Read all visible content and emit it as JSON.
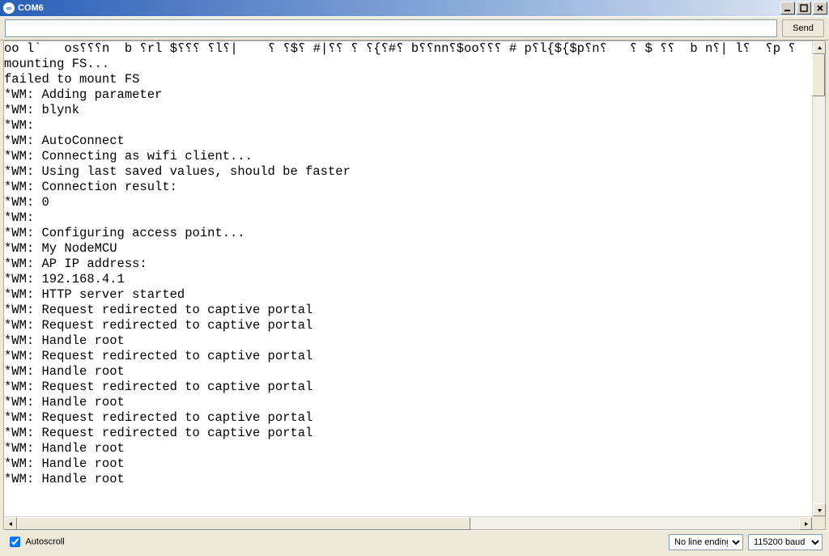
{
  "window": {
    "title": "COM6",
    "icon_glyph": "∞"
  },
  "toolbar": {
    "input_value": "",
    "send_label": "Send"
  },
  "console_lines": [
    "oo l`   os⸮⸮⸮n  b ⸮rl $⸮⸮⸮ ⸮l⸮|    ⸮ ⸮$⸮ #|⸮⸮ ⸮ ⸮{⸮#⸮ b⸮⸮nn⸮$oo⸮⸮⸮ # p⸮l{${$p⸮n⸮   ⸮ $ ⸮⸮  b n⸮| l⸮  ⸮p ⸮",
    "mounting FS...",
    "failed to mount FS",
    "*WM: Adding parameter",
    "*WM: blynk",
    "*WM: ",
    "*WM: AutoConnect",
    "*WM: Connecting as wifi client...",
    "*WM: Using last saved values, should be faster",
    "*WM: Connection result: ",
    "*WM: 0",
    "*WM: ",
    "*WM: Configuring access point... ",
    "*WM: My NodeMCU",
    "*WM: AP IP address: ",
    "*WM: 192.168.4.1",
    "*WM: HTTP server started",
    "*WM: Request redirected to captive portal",
    "*WM: Request redirected to captive portal",
    "*WM: Handle root",
    "*WM: Request redirected to captive portal",
    "*WM: Handle root",
    "*WM: Request redirected to captive portal",
    "*WM: Handle root",
    "*WM: Request redirected to captive portal",
    "*WM: Request redirected to captive portal",
    "*WM: Handle root",
    "*WM: Handle root",
    "*WM: Handle root"
  ],
  "statusbar": {
    "autoscroll_label": "Autoscroll",
    "autoscroll_checked": true,
    "line_ending_selected": "No line ending",
    "baud_selected": "115200 baud"
  }
}
